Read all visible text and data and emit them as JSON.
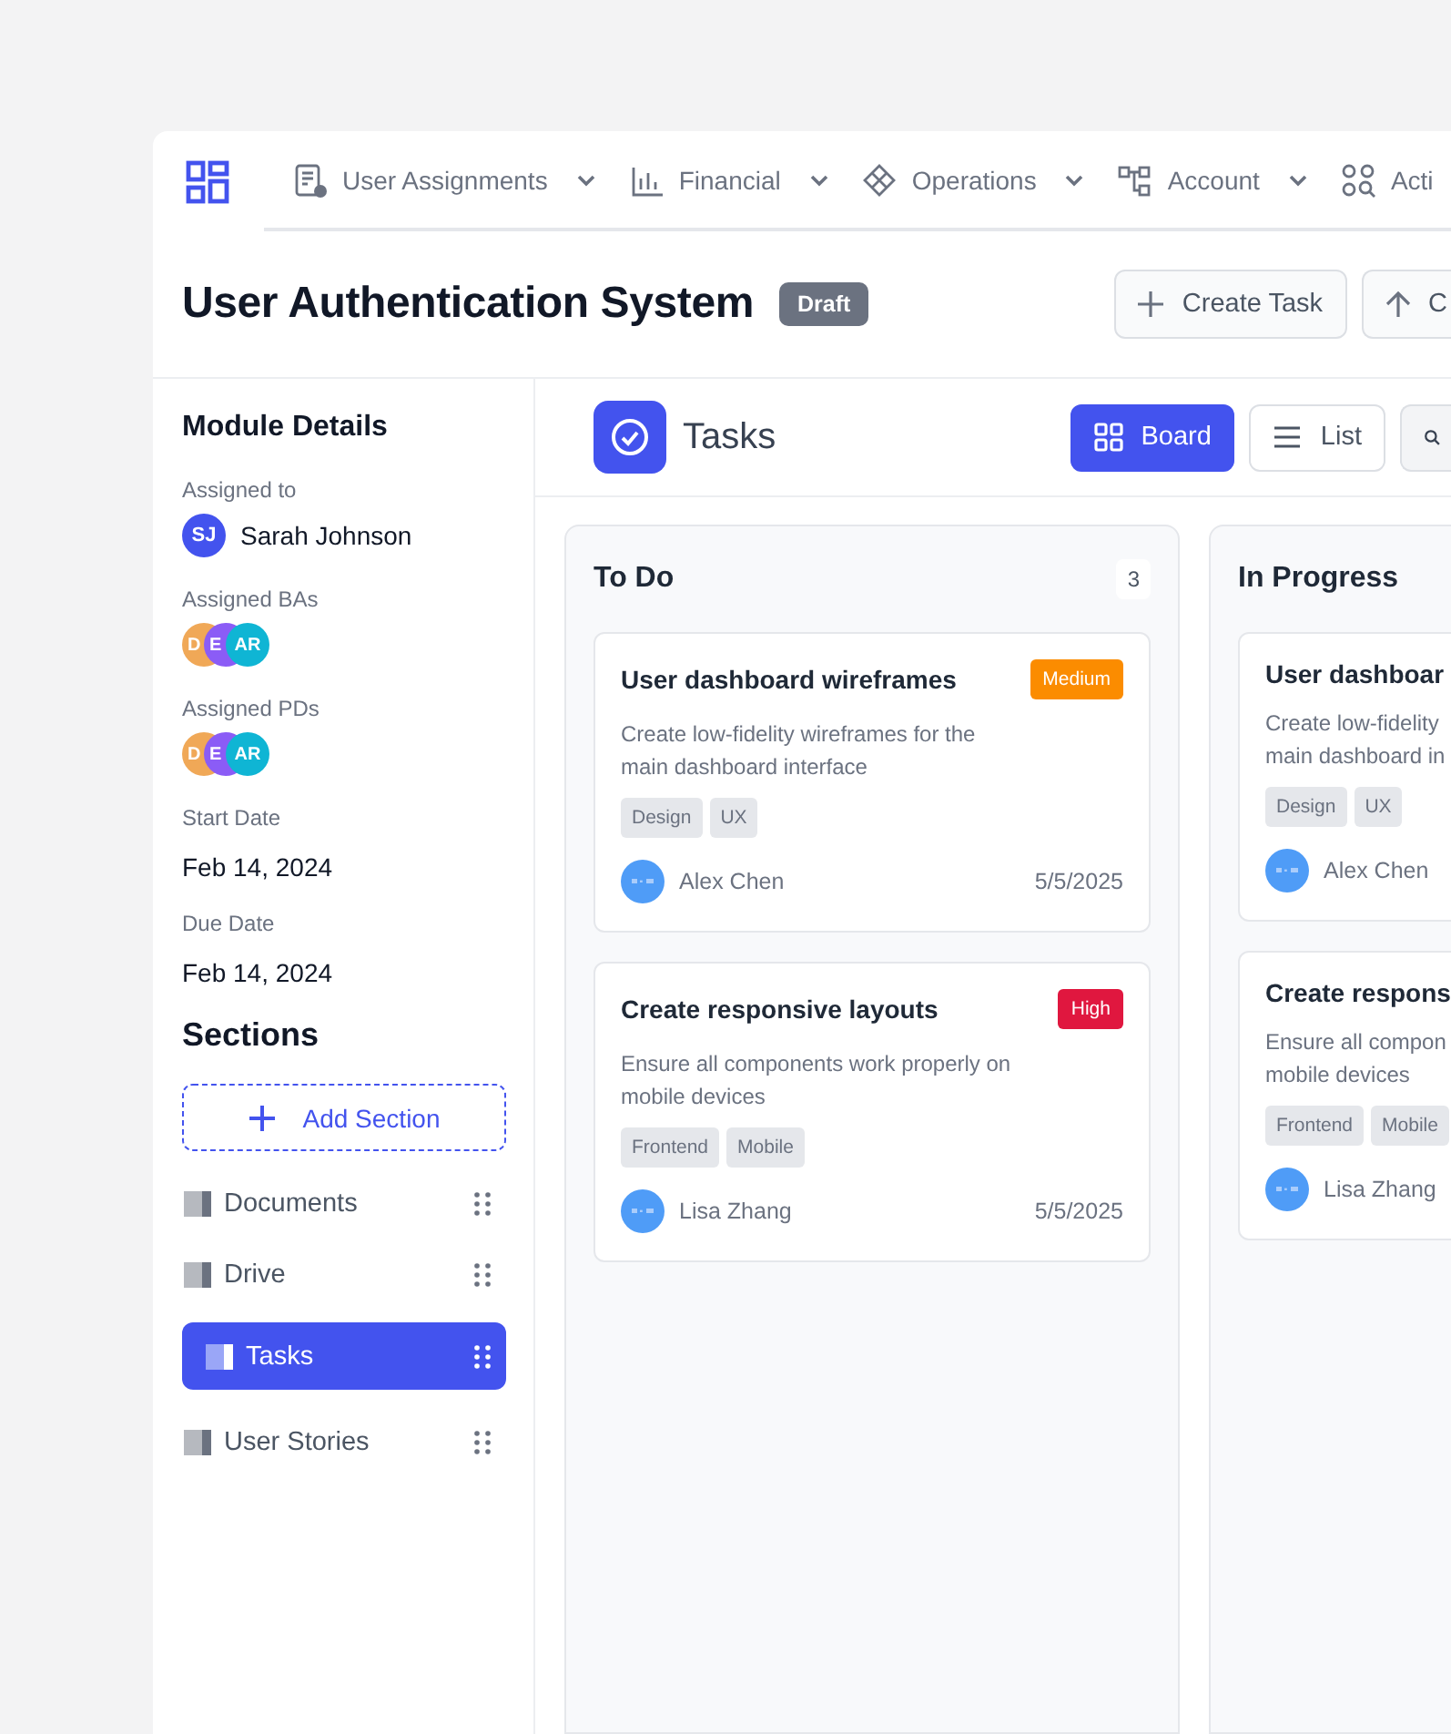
{
  "nav": {
    "items": [
      {
        "label": "User Assignments",
        "has_menu": true
      },
      {
        "label": "Financial",
        "has_menu": true
      },
      {
        "label": "Operations",
        "has_menu": true
      },
      {
        "label": "Account",
        "has_menu": true
      },
      {
        "label": "Acti",
        "has_menu": false
      }
    ]
  },
  "header": {
    "title": "User Authentication System",
    "status": "Draft",
    "actions": [
      {
        "label": "Create Task",
        "kind": "create"
      },
      {
        "label": "C",
        "kind": "upload"
      }
    ]
  },
  "sidebar": {
    "title": "Module Details",
    "assigned_to": {
      "label": "Assigned to",
      "initials": "SJ",
      "name": "Sarah Johnson",
      "color": "#4353ee"
    },
    "groups": [
      {
        "label": "Assigned BAs",
        "avatars": [
          {
            "initials": "D",
            "color": "#f0a857"
          },
          {
            "initials": "E",
            "color": "#8b5cf6"
          },
          {
            "initials": "AR",
            "color": "#0fb5d4"
          }
        ]
      },
      {
        "label": "Assigned PDs",
        "avatars": [
          {
            "initials": "D",
            "color": "#f0a857"
          },
          {
            "initials": "E",
            "color": "#8b5cf6"
          },
          {
            "initials": "AR",
            "color": "#0fb5d4"
          }
        ]
      }
    ],
    "dates": [
      {
        "label": "Start Date",
        "value": "Feb 14, 2024"
      },
      {
        "label": "Due Date",
        "value": "Feb 14, 2024"
      }
    ],
    "sections_title": "Sections",
    "add_section": "Add Section",
    "sections": [
      {
        "label": "Documents",
        "selected": false
      },
      {
        "label": "Drive",
        "selected": false
      },
      {
        "label": "Tasks",
        "selected": true
      },
      {
        "label": "User Stories",
        "selected": false
      }
    ]
  },
  "main": {
    "title": "Tasks",
    "views": [
      {
        "label": "Board",
        "kind": "board",
        "selected": true
      },
      {
        "label": "List",
        "kind": "list",
        "selected": false
      }
    ],
    "columns": [
      {
        "title": "To Do",
        "count": "3",
        "cards": [
          {
            "title": "User dashboard wireframes",
            "priority": {
              "label": "Medium",
              "color": "#fb8c00"
            },
            "description": "Create low-fidelity wireframes for the\nmain dashboard interface",
            "tags": [
              "Design",
              "UX"
            ],
            "assignee": "Alex Chen",
            "date": "5/5/2025"
          },
          {
            "title": "Create responsive layouts",
            "priority": {
              "label": "High",
              "color": "#e0173f"
            },
            "description": "Ensure all components work properly on\nmobile devices",
            "tags": [
              "Frontend",
              "Mobile"
            ],
            "assignee": "Lisa Zhang",
            "date": "5/5/2025"
          }
        ]
      },
      {
        "title": "In Progress",
        "cards": [
          {
            "title": "User dashboar",
            "description": "Create low-fidelity\nmain dashboard in",
            "tags": [
              "Design",
              "UX"
            ],
            "assignee": "Alex Chen"
          },
          {
            "title": "Create respons",
            "description": "Ensure all compon\nmobile devices",
            "tags": [
              "Frontend",
              "Mobile"
            ],
            "assignee": "Lisa Zhang"
          }
        ]
      }
    ]
  }
}
